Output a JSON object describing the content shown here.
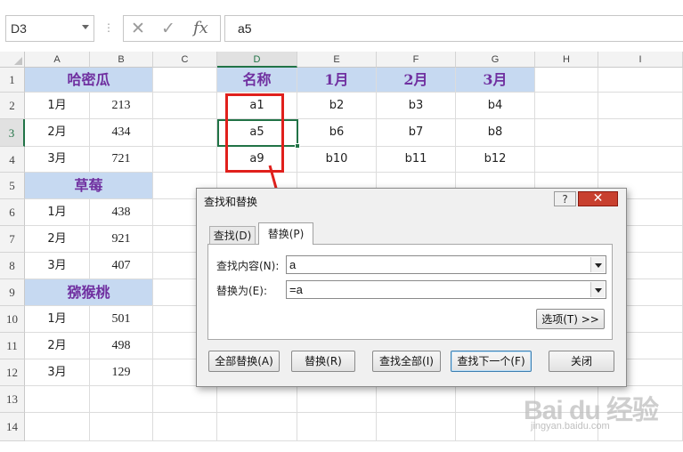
{
  "formula_bar": {
    "name_box": "D3",
    "cancel_icon": "✕",
    "enter_icon": "✓",
    "fx_label": "fx",
    "formula": "a5"
  },
  "columns": [
    "A",
    "B",
    "C",
    "D",
    "E",
    "F",
    "G",
    "H",
    "I"
  ],
  "selected_column": "D",
  "rows": [
    "1",
    "2",
    "3",
    "4",
    "5",
    "6",
    "7",
    "8",
    "9",
    "10",
    "11",
    "12",
    "13",
    "14"
  ],
  "selected_row": "3",
  "sheet": {
    "A1": "哈密瓜",
    "A2": "1月",
    "B2": "213",
    "A3": "2月",
    "B3": "434",
    "A4": "3月",
    "B4": "721",
    "A5": "草莓",
    "A6": "1月",
    "B6": "438",
    "A7": "2月",
    "B7": "921",
    "A8": "3月",
    "B8": "407",
    "A9": "猕猴桃",
    "A10": "1月",
    "B10": "501",
    "A11": "2月",
    "B11": "498",
    "A12": "3月",
    "B12": "129",
    "D1": "名称",
    "E1": "1月",
    "F1": "2月",
    "G1": "3月",
    "D2": "a1",
    "E2": "b2",
    "F2": "b3",
    "G2": "b4",
    "D3": "a5",
    "E3": "b6",
    "F3": "b7",
    "G3": "b8",
    "D4": "a9",
    "E4": "b10",
    "F4": "b11",
    "G4": "b12"
  },
  "header_fill_color": "#c6d9f1",
  "header_text_color": "#7030a0",
  "selection_color": "#217346",
  "annotation_color": "#e0201c",
  "dialog": {
    "title": "查找和替换",
    "help_icon": "?",
    "close_icon": "✕",
    "tab_find": "查找(D)",
    "tab_replace": "替换(P)",
    "find_label": "查找内容(N):",
    "find_value": "a",
    "replace_label": "替换为(E):",
    "replace_value": "=a",
    "options_button": "选项(T) >>",
    "replace_all_button": "全部替换(A)",
    "replace_button": "替换(R)",
    "find_all_button": "查找全部(I)",
    "find_next_button": "查找下一个(F)",
    "close_button": "关闭"
  },
  "watermark": {
    "logo": "Bai du 经验",
    "url": "jingyan.baidu.com"
  }
}
